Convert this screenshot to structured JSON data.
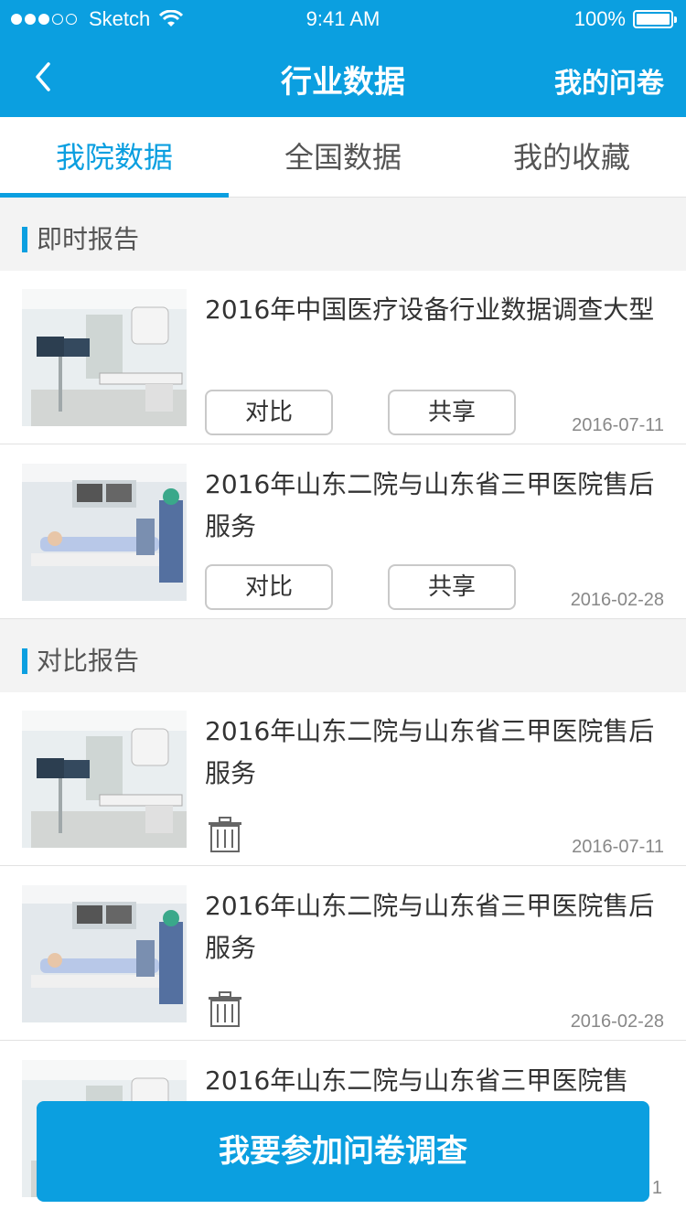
{
  "status": {
    "carrier": "Sketch",
    "time": "9:41 AM",
    "battery": "100%"
  },
  "nav": {
    "title": "行业数据",
    "right": "我的问卷"
  },
  "tabs": [
    {
      "label": "我院数据",
      "active": true
    },
    {
      "label": "全国数据",
      "active": false
    },
    {
      "label": "我的收藏",
      "active": false
    }
  ],
  "sections": {
    "instant": {
      "title": "即时报告",
      "items": [
        {
          "title": "2016年中国医疗设备行业数据调查大型",
          "compare": "对比",
          "share": "共享",
          "date": "2016-07-11",
          "image": "xray-room-image"
        },
        {
          "title": "2016年山东二院与山东省三甲医院售后服务",
          "compare": "对比",
          "share": "共享",
          "date": "2016-02-28",
          "image": "patient-scan-image"
        }
      ]
    },
    "compare": {
      "title": "对比报告",
      "items": [
        {
          "title": "2016年山东二院与山东省三甲医院售后服务",
          "date": "2016-07-11",
          "image": "xray-room-image",
          "icon": "trash-icon"
        },
        {
          "title": "2016年山东二院与山东省三甲医院售后服务",
          "date": "2016-02-28",
          "image": "patient-scan-image",
          "icon": "trash-icon"
        },
        {
          "title": "2016年山东二院与山东省三甲医院售",
          "date": "1",
          "image": "xray-room-image"
        }
      ]
    }
  },
  "cta": {
    "label": "我要参加问卷调查"
  },
  "colors": {
    "brand": "#0b9fe0",
    "separator": "#f3f3f3",
    "muted": "#888888"
  }
}
